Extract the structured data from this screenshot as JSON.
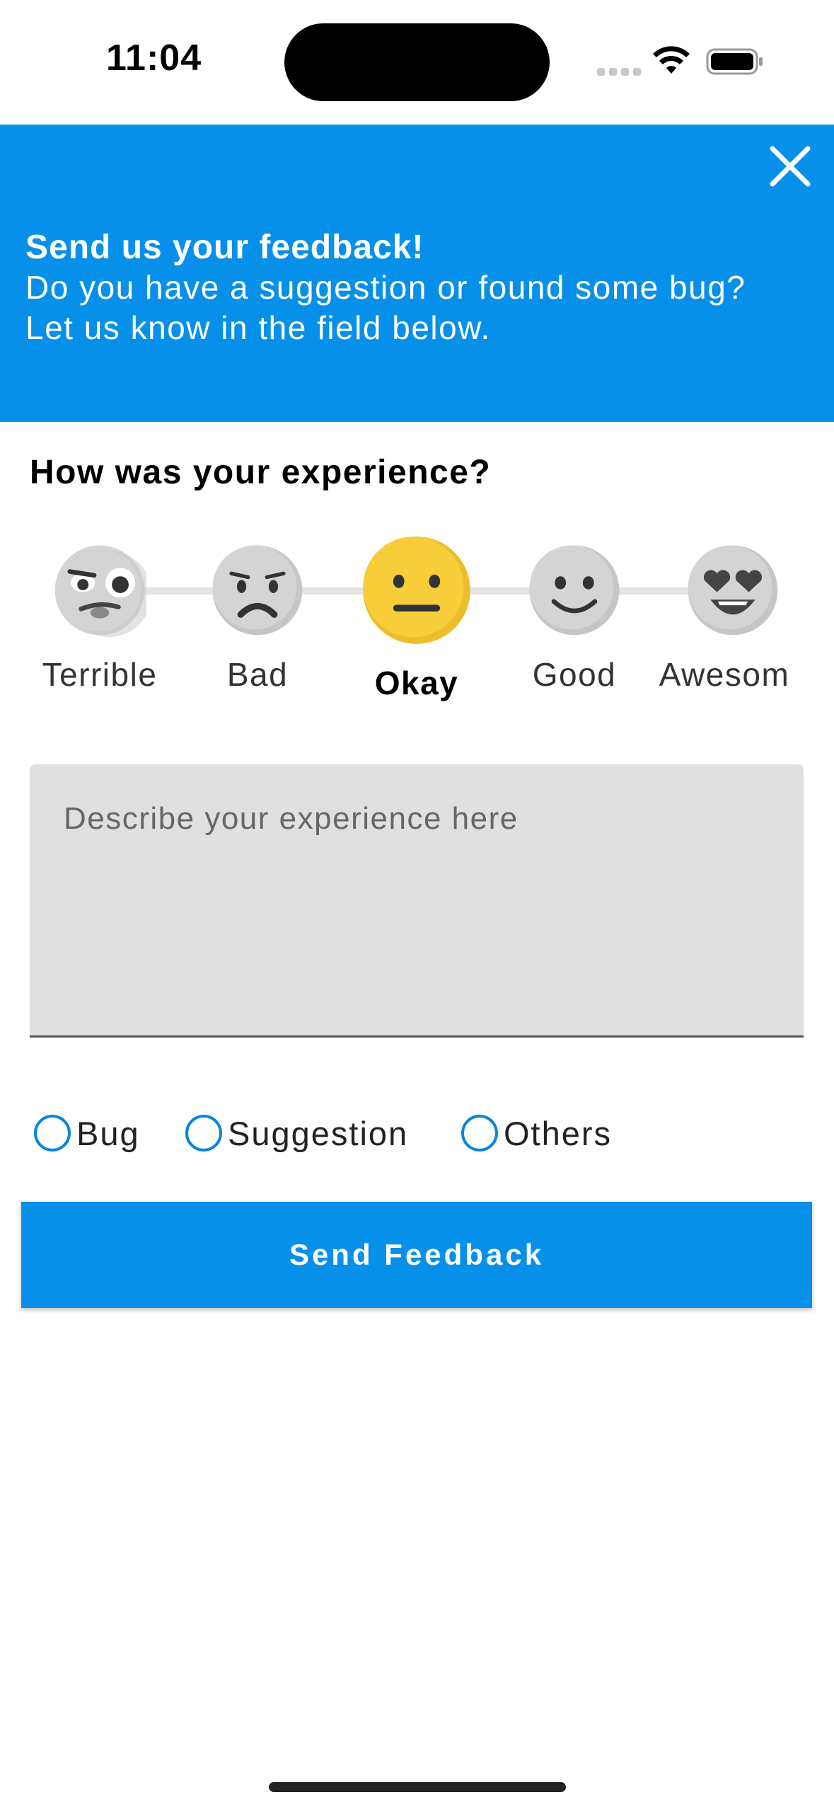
{
  "status_bar": {
    "time": "11:04"
  },
  "header": {
    "title": "Send us your feedback!",
    "line1": "Do you have a suggestion or found some bug?",
    "line2": "Let us know in the field below.",
    "background": "#0690e9"
  },
  "question": "How was your experience?",
  "ratings": [
    {
      "label": "Terrible",
      "icon": "terrible-face-icon",
      "selected": false
    },
    {
      "label": "Bad",
      "icon": "bad-face-icon",
      "selected": false
    },
    {
      "label": "Okay",
      "icon": "okay-face-icon",
      "selected": true
    },
    {
      "label": "Good",
      "icon": "good-face-icon",
      "selected": false
    },
    {
      "label": "Awesom",
      "icon": "awesome-face-icon",
      "selected": false
    }
  ],
  "feedback": {
    "placeholder": "Describe your experience here",
    "value": ""
  },
  "types": [
    {
      "label": "Bug",
      "checked": false
    },
    {
      "label": "Suggestion",
      "checked": false
    },
    {
      "label": "Others",
      "checked": false
    }
  ],
  "submit_label": "Send Feedback",
  "colors": {
    "accent": "#0690e9",
    "selected_face": "#f7cd3a",
    "inactive_face": "#d4d4d4"
  }
}
